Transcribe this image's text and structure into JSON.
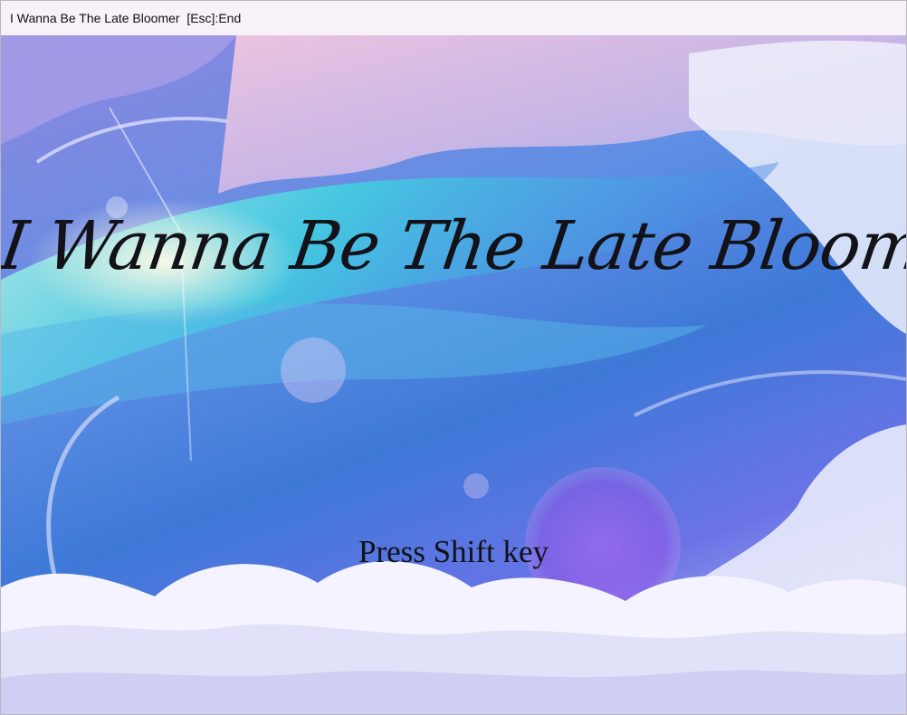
{
  "window": {
    "title": "I Wanna Be The Late Bloomer  [Esc]:End"
  },
  "game": {
    "title": "I Wanna Be The Late Bloomer",
    "prompt": "Press Shift key"
  },
  "colors": {
    "sky_violet": "#8d86df",
    "sky_blue": "#3e79d8",
    "aqua_band": "#3fd0e0",
    "cloud_white": "#f4f3ff",
    "orb_purple": "#9d4fe6"
  }
}
